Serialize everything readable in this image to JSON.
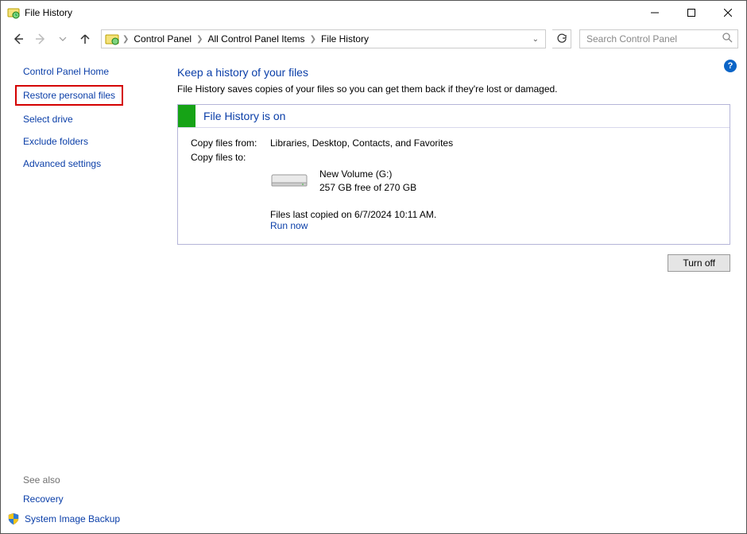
{
  "window": {
    "title": "File History"
  },
  "breadcrumbs": {
    "0": "Control Panel",
    "1": "All Control Panel Items",
    "2": "File History"
  },
  "search": {
    "placeholder": "Search Control Panel"
  },
  "sidebar": {
    "home": "Control Panel Home",
    "restore": "Restore personal files",
    "select_drive": "Select drive",
    "exclude": "Exclude folders",
    "advanced": "Advanced settings",
    "see_also": "See also",
    "recovery": "Recovery",
    "system_image": "System Image Backup"
  },
  "main": {
    "heading": "Keep a history of your files",
    "subtitle": "File History saves copies of your files so you can get them back if they're lost or damaged.",
    "status_title": "File History is on",
    "copy_from_label": "Copy files from:",
    "copy_from_value": "Libraries, Desktop, Contacts, and Favorites",
    "copy_to_label": "Copy files to:",
    "drive_name": "New Volume (G:)",
    "drive_free": "257 GB free of 270 GB",
    "last_copied": "Files last copied on 6/7/2024 10:11 AM.",
    "run_now": "Run now",
    "turn_off": "Turn off"
  },
  "help_badge": "?"
}
